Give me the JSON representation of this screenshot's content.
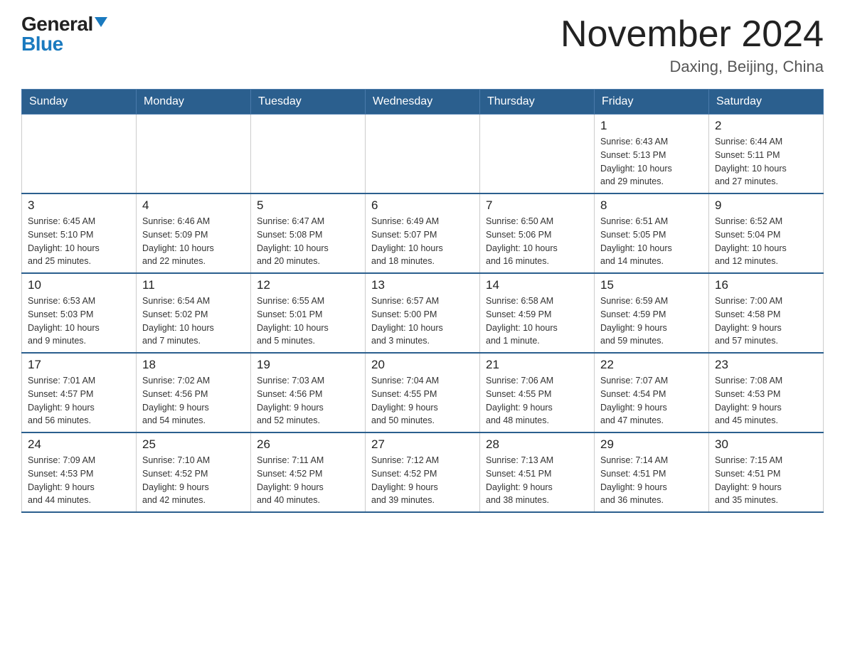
{
  "header": {
    "logo_general": "General",
    "logo_blue": "Blue",
    "month_title": "November 2024",
    "location": "Daxing, Beijing, China"
  },
  "days_of_week": [
    "Sunday",
    "Monday",
    "Tuesday",
    "Wednesday",
    "Thursday",
    "Friday",
    "Saturday"
  ],
  "weeks": [
    [
      {
        "day": "",
        "info": ""
      },
      {
        "day": "",
        "info": ""
      },
      {
        "day": "",
        "info": ""
      },
      {
        "day": "",
        "info": ""
      },
      {
        "day": "",
        "info": ""
      },
      {
        "day": "1",
        "info": "Sunrise: 6:43 AM\nSunset: 5:13 PM\nDaylight: 10 hours\nand 29 minutes."
      },
      {
        "day": "2",
        "info": "Sunrise: 6:44 AM\nSunset: 5:11 PM\nDaylight: 10 hours\nand 27 minutes."
      }
    ],
    [
      {
        "day": "3",
        "info": "Sunrise: 6:45 AM\nSunset: 5:10 PM\nDaylight: 10 hours\nand 25 minutes."
      },
      {
        "day": "4",
        "info": "Sunrise: 6:46 AM\nSunset: 5:09 PM\nDaylight: 10 hours\nand 22 minutes."
      },
      {
        "day": "5",
        "info": "Sunrise: 6:47 AM\nSunset: 5:08 PM\nDaylight: 10 hours\nand 20 minutes."
      },
      {
        "day": "6",
        "info": "Sunrise: 6:49 AM\nSunset: 5:07 PM\nDaylight: 10 hours\nand 18 minutes."
      },
      {
        "day": "7",
        "info": "Sunrise: 6:50 AM\nSunset: 5:06 PM\nDaylight: 10 hours\nand 16 minutes."
      },
      {
        "day": "8",
        "info": "Sunrise: 6:51 AM\nSunset: 5:05 PM\nDaylight: 10 hours\nand 14 minutes."
      },
      {
        "day": "9",
        "info": "Sunrise: 6:52 AM\nSunset: 5:04 PM\nDaylight: 10 hours\nand 12 minutes."
      }
    ],
    [
      {
        "day": "10",
        "info": "Sunrise: 6:53 AM\nSunset: 5:03 PM\nDaylight: 10 hours\nand 9 minutes."
      },
      {
        "day": "11",
        "info": "Sunrise: 6:54 AM\nSunset: 5:02 PM\nDaylight: 10 hours\nand 7 minutes."
      },
      {
        "day": "12",
        "info": "Sunrise: 6:55 AM\nSunset: 5:01 PM\nDaylight: 10 hours\nand 5 minutes."
      },
      {
        "day": "13",
        "info": "Sunrise: 6:57 AM\nSunset: 5:00 PM\nDaylight: 10 hours\nand 3 minutes."
      },
      {
        "day": "14",
        "info": "Sunrise: 6:58 AM\nSunset: 4:59 PM\nDaylight: 10 hours\nand 1 minute."
      },
      {
        "day": "15",
        "info": "Sunrise: 6:59 AM\nSunset: 4:59 PM\nDaylight: 9 hours\nand 59 minutes."
      },
      {
        "day": "16",
        "info": "Sunrise: 7:00 AM\nSunset: 4:58 PM\nDaylight: 9 hours\nand 57 minutes."
      }
    ],
    [
      {
        "day": "17",
        "info": "Sunrise: 7:01 AM\nSunset: 4:57 PM\nDaylight: 9 hours\nand 56 minutes."
      },
      {
        "day": "18",
        "info": "Sunrise: 7:02 AM\nSunset: 4:56 PM\nDaylight: 9 hours\nand 54 minutes."
      },
      {
        "day": "19",
        "info": "Sunrise: 7:03 AM\nSunset: 4:56 PM\nDaylight: 9 hours\nand 52 minutes."
      },
      {
        "day": "20",
        "info": "Sunrise: 7:04 AM\nSunset: 4:55 PM\nDaylight: 9 hours\nand 50 minutes."
      },
      {
        "day": "21",
        "info": "Sunrise: 7:06 AM\nSunset: 4:55 PM\nDaylight: 9 hours\nand 48 minutes."
      },
      {
        "day": "22",
        "info": "Sunrise: 7:07 AM\nSunset: 4:54 PM\nDaylight: 9 hours\nand 47 minutes."
      },
      {
        "day": "23",
        "info": "Sunrise: 7:08 AM\nSunset: 4:53 PM\nDaylight: 9 hours\nand 45 minutes."
      }
    ],
    [
      {
        "day": "24",
        "info": "Sunrise: 7:09 AM\nSunset: 4:53 PM\nDaylight: 9 hours\nand 44 minutes."
      },
      {
        "day": "25",
        "info": "Sunrise: 7:10 AM\nSunset: 4:52 PM\nDaylight: 9 hours\nand 42 minutes."
      },
      {
        "day": "26",
        "info": "Sunrise: 7:11 AM\nSunset: 4:52 PM\nDaylight: 9 hours\nand 40 minutes."
      },
      {
        "day": "27",
        "info": "Sunrise: 7:12 AM\nSunset: 4:52 PM\nDaylight: 9 hours\nand 39 minutes."
      },
      {
        "day": "28",
        "info": "Sunrise: 7:13 AM\nSunset: 4:51 PM\nDaylight: 9 hours\nand 38 minutes."
      },
      {
        "day": "29",
        "info": "Sunrise: 7:14 AM\nSunset: 4:51 PM\nDaylight: 9 hours\nand 36 minutes."
      },
      {
        "day": "30",
        "info": "Sunrise: 7:15 AM\nSunset: 4:51 PM\nDaylight: 9 hours\nand 35 minutes."
      }
    ]
  ]
}
